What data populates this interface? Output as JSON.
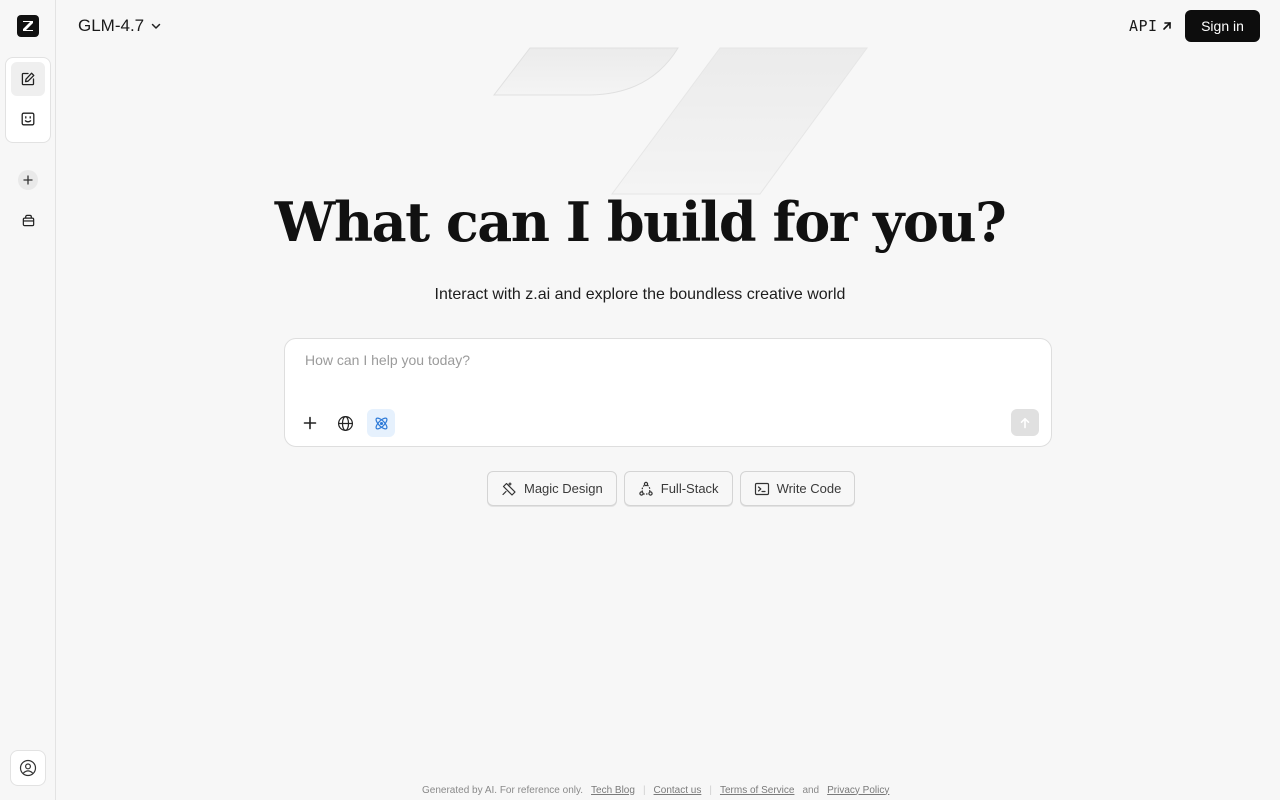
{
  "header": {
    "model": "GLM-4.7",
    "api_label": "API",
    "signin_label": "Sign in"
  },
  "hero": {
    "title": "What can I build for you?",
    "subtitle": "Interact with z.ai and explore the boundless creative world"
  },
  "input": {
    "placeholder": "How can I help you today?",
    "value": ""
  },
  "chips": [
    {
      "label": "Magic Design",
      "icon": "magic-design-icon"
    },
    {
      "label": "Full-Stack",
      "icon": "full-stack-icon"
    },
    {
      "label": "Write Code",
      "icon": "terminal-icon"
    }
  ],
  "footer": {
    "generated": "Generated by AI. For reference only.",
    "tech_blog": "Tech Blog",
    "contact": "Contact us",
    "terms": "Terms of Service",
    "and": "and",
    "privacy": "Privacy Policy"
  },
  "colors": {
    "background": "#f7f7f7",
    "signin_bg": "#0d0d0d",
    "accent_blue": "#2f7bd8",
    "active_tool_bg": "#e6f1fd"
  },
  "icons": {
    "logo": "z-logo-icon",
    "new_chat": "edit-icon",
    "agent": "robot-face-icon",
    "add": "plus-icon",
    "library": "bag-icon",
    "profile": "user-circle-icon",
    "attach": "plus-icon",
    "web_search": "globe-icon",
    "deep_think": "atom-icon",
    "send": "arrow-up-icon"
  }
}
